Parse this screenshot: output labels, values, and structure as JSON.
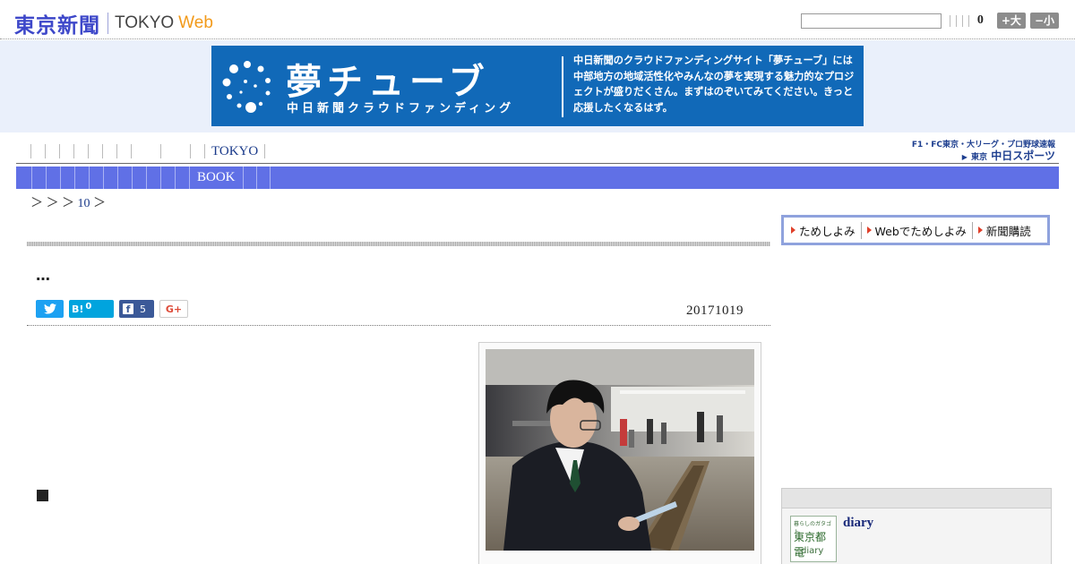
{
  "header": {
    "logo_jp": "東京新聞",
    "logo_tokyo": "TOKYO",
    "logo_web": "Web",
    "search_value": "",
    "font_size_count": "0",
    "font_larger_label": "+大",
    "font_smaller_label": "−小"
  },
  "banner": {
    "title": "夢チューブ",
    "subtitle": "中日新聞クラウドファンディング",
    "description": "中日新聞のクラウドファンディングサイト「夢チューブ」には中部地方の地域活性化やみんなの夢を実現する魅力的なプロジェクトが盛りだくさん。まずはのぞいてみてください。きっと応援したくなるはず。"
  },
  "nav": {
    "tokyo_label": "TOKYO",
    "book_label": "BOOK",
    "chunichi_line1": "F1・FC東京・大リーグ・プロ野球速報",
    "chunichi_tokyo": "東京",
    "chunichi_name": "中日スポーツ"
  },
  "breadcrumb": {
    "arrows": "＞ ＞ ＞",
    "link": "10",
    "trailing": "＞"
  },
  "subscribe": {
    "items": [
      "ためしよみ",
      "Webでためしよみ",
      "新聞購読"
    ]
  },
  "article": {
    "title": "…",
    "date": "20171019",
    "social": {
      "hatena_label": "B!",
      "hatena_count": "0",
      "facebook_count": "5",
      "google_label": "G+"
    }
  },
  "sidebar": {
    "diary_thumb_line1": "暮らしのガタゴト",
    "diary_thumb_line2": "東京都電",
    "diary_thumb_line3": "diary",
    "diary_link": "diary"
  },
  "colors": {
    "logo_blue": "#3d47c9",
    "web_orange": "#f29a1a",
    "nav_bar": "#6070e6",
    "banner_blue": "#1169b8",
    "twitter": "#1da1f2",
    "hatena": "#00a4de",
    "facebook": "#3b5998"
  }
}
